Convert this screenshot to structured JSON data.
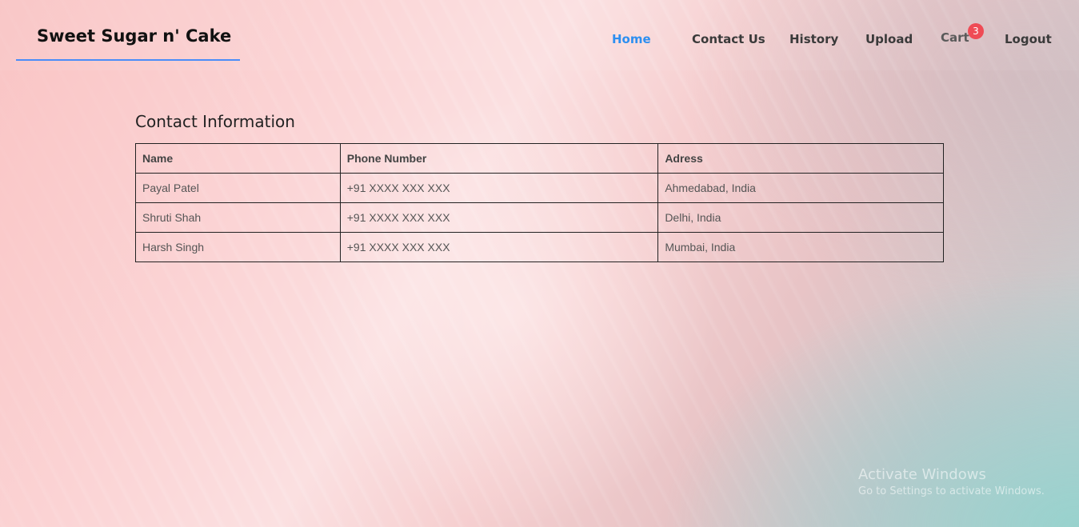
{
  "brand": {
    "name": "Sweet Sugar n' Cake"
  },
  "nav": {
    "home": "Home",
    "contact": "Contact Us",
    "history": "History",
    "upload": "Upload",
    "cart": "Cart",
    "cart_count": "3",
    "logout": "Logout"
  },
  "colors": {
    "accent": "#2d8ff0",
    "badge": "#ef4b55",
    "brand_underline": "#4a8df8"
  },
  "contact": {
    "title": "Contact Information",
    "headers": [
      "Name",
      "Phone Number",
      "Adress"
    ],
    "rows": [
      [
        "Payal Patel",
        "+91 XXXX XXX XXX",
        "Ahmedabad, India"
      ],
      [
        "Shruti Shah",
        "+91 XXXX XXX XXX",
        "Delhi, India"
      ],
      [
        "Harsh Singh",
        "+91 XXXX XXX XXX",
        "Mumbai, India"
      ]
    ]
  },
  "watermark": {
    "title": "Activate Windows",
    "subtitle": "Go to Settings to activate Windows."
  }
}
